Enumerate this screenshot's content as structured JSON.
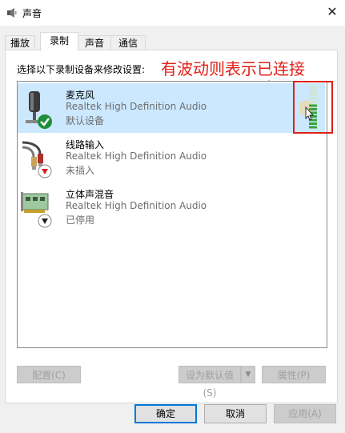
{
  "window": {
    "title": "声音",
    "close_glyph": "✕"
  },
  "tabs": [
    {
      "label": "播放",
      "active": false
    },
    {
      "label": "录制",
      "active": true
    },
    {
      "label": "声音",
      "active": false
    },
    {
      "label": "通信",
      "active": false
    }
  ],
  "instruction": "选择以下录制设备来修改设置:",
  "annotation": "有波动则表示已连接",
  "devices": [
    {
      "name": "麦克风",
      "driver": "Realtek High Definition Audio",
      "status": "默认设备",
      "icon": "microphone-icon",
      "badge": "default-check-icon",
      "selected": true
    },
    {
      "name": "线路输入",
      "driver": "Realtek High Definition Audio",
      "status": "未插入",
      "icon": "line-in-cable-icon",
      "badge": "unplugged-arrow-icon",
      "selected": false
    },
    {
      "name": "立体声混音",
      "driver": "Realtek High Definition Audio",
      "status": "已停用",
      "icon": "sound-card-icon",
      "badge": "disabled-arrow-icon",
      "selected": false
    }
  ],
  "level_meter": {
    "level": 0.6,
    "colors": {
      "lit": "#3aa33a",
      "unlit": "#cfe6cf"
    }
  },
  "buttons": {
    "configure": "配置(C)",
    "set_default": "设为默认值(S)",
    "properties": "属性(P)",
    "ok": "确定",
    "cancel": "取消",
    "apply": "应用(A)"
  },
  "colors": {
    "accent": "#0078d7",
    "selection": "#cce8ff",
    "annotation": "#e0201a"
  }
}
